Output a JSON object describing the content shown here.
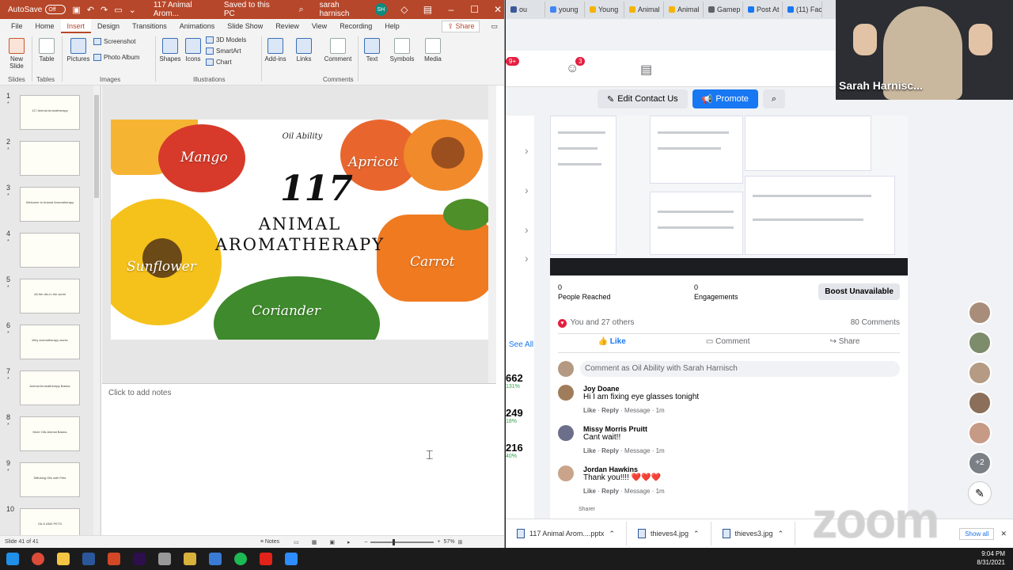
{
  "ppt": {
    "autosave_label": "AutoSave",
    "autosave_state": "Off",
    "doc_title": "117 Animal Arom...",
    "saved_status": "Saved to this PC",
    "user_name": "sarah harnisch",
    "user_initials": "SH",
    "tabs": [
      "File",
      "Home",
      "Insert",
      "Design",
      "Transitions",
      "Animations",
      "Slide Show",
      "Review",
      "View",
      "Recording",
      "Help"
    ],
    "share_label": "Share",
    "ribbon": {
      "new_slide": "New Slide",
      "table": "Table",
      "pictures": "Pictures",
      "screenshot": "Screenshot",
      "photo_album": "Photo Album",
      "shapes": "Shapes",
      "icons": "Icons",
      "models_3d": "3D Models",
      "smartart": "SmartArt",
      "chart": "Chart",
      "addins": "Add-ins",
      "links": "Links",
      "comment": "Comment",
      "text": "Text",
      "symbols": "Symbols",
      "media": "Media",
      "groups": [
        "Slides",
        "Tables",
        "Images",
        "Illustrations",
        "Comments"
      ]
    },
    "thumbnails": [
      {
        "num": "1",
        "star": "*",
        "text": "117 Animal Aromatherapy"
      },
      {
        "num": "2",
        "star": "*",
        "text": ""
      },
      {
        "num": "3",
        "star": "*",
        "text": "Welcome to Animal Aromatherapy"
      },
      {
        "num": "4",
        "star": "*",
        "text": ""
      },
      {
        "num": "5",
        "star": "*",
        "text": "All the oils in the world"
      },
      {
        "num": "6",
        "star": "*",
        "text": "Why aromatherapy works"
      },
      {
        "num": "7",
        "star": "*",
        "text": "Animal Aromatherapy Basics"
      },
      {
        "num": "8",
        "star": "*",
        "text": "More Oils Animal Basics"
      },
      {
        "num": "9",
        "star": "*",
        "text": "Diffusing Oils with Pets"
      },
      {
        "num": "10",
        "star": "",
        "text": "OILS AND PETS"
      }
    ],
    "slide": {
      "logo": "Oil Ability",
      "number": "117",
      "line1": "ANIMAL",
      "line2": "AROMATHERAPY",
      "labels": {
        "mango": "Mango",
        "apricot": "Apricot",
        "sunflower": "Sunflower",
        "carrot": "Carrot",
        "coriander": "Coriander"
      }
    },
    "notes_placeholder": "Click to add notes",
    "status": {
      "slide_info": "Slide 41 of 41",
      "notes": "Notes",
      "zoom": "57%"
    }
  },
  "browser": {
    "tabs": [
      {
        "label": "ou",
        "color": "#3b5998"
      },
      {
        "label": "young",
        "color": "#4285f4"
      },
      {
        "label": "Young",
        "color": "#f4b400"
      },
      {
        "label": "Animal",
        "color": "#f4b400"
      },
      {
        "label": "Animal",
        "color": "#f4b400"
      },
      {
        "label": "Gamep",
        "color": "#5f6368"
      },
      {
        "label": "Post At",
        "color": "#1877f2"
      },
      {
        "label": "(11) Fac",
        "color": "#1877f2"
      }
    ],
    "badges": {
      "left": "9+",
      "people": "3"
    },
    "buttons": {
      "edit_contact": "Edit Contact Us",
      "promote": "Promote"
    },
    "see_all": "See All",
    "stats": [
      {
        "value": "662",
        "pct": "131%"
      },
      {
        "value": "249",
        "pct": "18%"
      },
      {
        "value": "216",
        "pct": "40%"
      }
    ],
    "post": {
      "people_reached_value": "0",
      "people_reached_label": "People Reached",
      "engagements_value": "0",
      "engagements_label": "Engagements",
      "boost": "Boost Unavailable",
      "reactions": "You and 27 others",
      "comments_count": "80 Comments",
      "like": "Like",
      "comment": "Comment",
      "share": "Share",
      "comment_placeholder": "Comment as Oil Ability with Sarah Harnisch",
      "comments": [
        {
          "name": "Joy Doane",
          "text": "Hi I am fixing eye glasses tonight",
          "like": "Like",
          "reply": "Reply",
          "message": "Message",
          "time": "1m"
        },
        {
          "name": "Missy Morris Pruitt",
          "text": "Cant wait!!",
          "like": "Like",
          "reply": "Reply",
          "message": "Message",
          "time": "1m"
        },
        {
          "name": "Jordan Hawkins",
          "text": "Thank you!!!! ❤️❤️❤️",
          "like": "Like",
          "reply": "Reply",
          "message": "Message",
          "time": "1m"
        }
      ],
      "sharer": "Sharer"
    },
    "right_avatars_more": "+2",
    "downloads": [
      "117 Animal Arom....pptx",
      "thieves4.jpg",
      "thieves3.jpg"
    ],
    "show_all": "Show all"
  },
  "zoom": {
    "participant_name": "Sarah Harnisc...",
    "watermark": "zoom"
  },
  "taskbar": {
    "time": "9:04 PM",
    "date": "8/31/2021"
  }
}
